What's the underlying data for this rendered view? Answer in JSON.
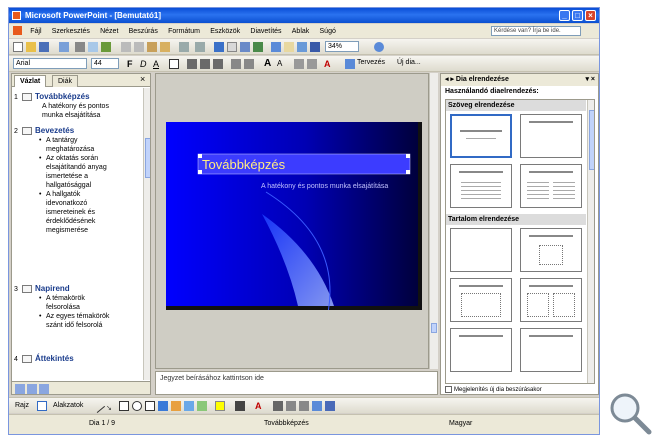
{
  "window": {
    "title": "Microsoft PowerPoint - [Bemutató1]"
  },
  "menu": [
    "Fájl",
    "Szerkesztés",
    "Nézet",
    "Beszúrás",
    "Formátum",
    "Eszközök",
    "Diavetítés",
    "Ablak",
    "Súgó"
  ],
  "help_placeholder": "Kérdése van? Írja be ide.",
  "format_toolbar": {
    "font": "Arial",
    "size": "44",
    "zoom": "34%",
    "design_label": "Tervezés",
    "new_slide_label": "Új dia..."
  },
  "tabs": {
    "outline": "Vázlat",
    "slides": "Diák"
  },
  "outline": [
    {
      "num": "1",
      "title": "Továbbképzés",
      "body": [
        "A hatékony és pontos",
        "munka elsajátítása"
      ]
    },
    {
      "num": "2",
      "title": "Bevezetés",
      "bullets": [
        [
          "A tantárgy",
          "meghatározása"
        ],
        [
          "Az oktatás során",
          "elsajátítandó anyag",
          "ismertetése a",
          "hallgatósággal"
        ],
        [
          "A hallgatók",
          "idevonatkozó",
          "ismereteinek és",
          "érdeklődésének",
          "megismerése"
        ]
      ]
    },
    {
      "num": "3",
      "title": "Napirend",
      "bullets": [
        [
          "A témakörök",
          "felsorolása"
        ],
        [
          "Az egyes témakörök",
          "szánt idő felsorolá"
        ]
      ]
    },
    {
      "num": "4",
      "title": "Áttekintés"
    }
  ],
  "slide": {
    "title": "Továbbképzés",
    "subtitle": "A hatékony és pontos munka elsajátítása"
  },
  "notes_placeholder": "Jegyzet beírásához kattintson ide",
  "task_pane": {
    "title": "Dia elrendezése",
    "apply_label": "Használandó diaelrendezés:",
    "sections": [
      "Szöveg elrendezése",
      "Tartalom elrendezése"
    ],
    "checkbox_label": "Megjelenítés új dia beszúrásakor"
  },
  "drawing_toolbar": {
    "draw_label": "Rajz",
    "autoshapes_label": "Alakzatok"
  },
  "status": {
    "slide": "Dia 1 / 9",
    "design": "Továbbképzés",
    "language": "Magyar"
  },
  "colors": {
    "titlebar": "#0a4ed6",
    "slide_bg": "#0000c8",
    "title_bar": "#3c3cff"
  }
}
